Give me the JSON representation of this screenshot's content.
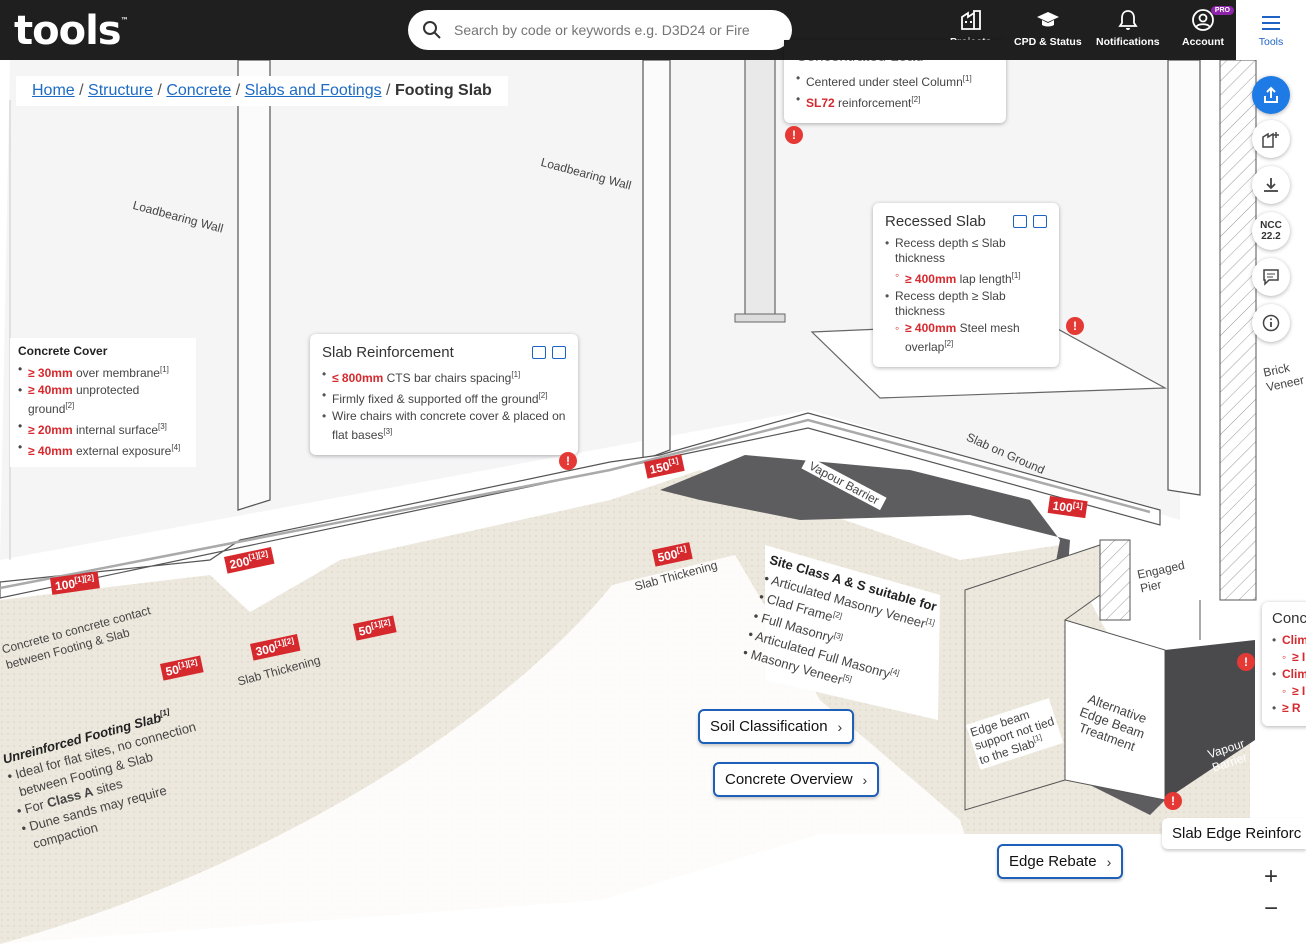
{
  "header": {
    "logo": "tools",
    "logo_tm": "™",
    "search_placeholder": "Search by code or keywords e.g. D3D24 or Fire",
    "nav": {
      "projects": "Projects",
      "cpd": "CPD & Status",
      "notifications": "Notifications",
      "account": "Account",
      "account_badge": "PRO",
      "tools": "Tools"
    }
  },
  "breadcrumb": {
    "items": [
      "Home",
      "Structure",
      "Concrete",
      "Slabs and Footings"
    ],
    "sep": "/",
    "current": "Footing Slab"
  },
  "concrete_cover": {
    "title": "Concrete Cover",
    "items": [
      {
        "v": "≥ 30mm",
        "t": " over membrane",
        "s": "[1]"
      },
      {
        "v": "≥ 40mm",
        "t": " unprotected ground",
        "s": "[2]"
      },
      {
        "v": "≥ 20mm",
        "t": " internal surface",
        "s": "[3]"
      },
      {
        "v": "≥ 40mm",
        "t": " external exposure",
        "s": "[4]"
      }
    ]
  },
  "slab_reinforcement": {
    "title": "Slab Reinforcement",
    "i1": {
      "v": "≤ 800mm",
      "t": " CTS bar chairs spacing",
      "s": "[1]"
    },
    "i2": {
      "t": "Firmly fixed & supported off the ground",
      "s": "[2]"
    },
    "i3": {
      "t": "Wire chairs with concrete cover & placed on flat bases",
      "s": "[3]"
    }
  },
  "concentrated_load": {
    "title": "Concentrated Load",
    "i1": {
      "t": "Centered under steel Column",
      "s": "[1]"
    },
    "i2": {
      "v": "SL72",
      "t": " reinforcement",
      "s": "[2]"
    }
  },
  "recessed_slab": {
    "title": "Recessed Slab",
    "i1": {
      "t": "Recess depth ≤ Slab thickness"
    },
    "i1s": {
      "v": "≥ 400mm",
      "t": " lap length",
      "s": "[1]"
    },
    "i2": {
      "t": "Recess depth ≥ Slab thickness"
    },
    "i2s": {
      "v": "≥ 400mm",
      "t": " Steel mesh overlap",
      "s": "[2]"
    }
  },
  "site_class": {
    "title": "Site Class A & S suitable for",
    "items": [
      {
        "t": "Articulated Masonry Veneer",
        "s": "[1]"
      },
      {
        "t": "Clad Frame",
        "s": "[2]"
      },
      {
        "t": "Full Masonry",
        "s": "[3]"
      },
      {
        "t": "Articulated Full Masonry",
        "s": "[4]"
      },
      {
        "t": "Masonry Veneer",
        "s": "[5]"
      }
    ]
  },
  "unreinforced": {
    "title": "Unreinforced Footing Slab",
    "title_s": "[1]",
    "l1": "Ideal for flat sites, no connection",
    "l2": "between Footing & Slab",
    "l3a": "For ",
    "l3b": "Class A",
    "l3c": " sites",
    "l4": "Dune sands may require",
    "l5": "compaction"
  },
  "contact_note": {
    "l1": "Concrete to concrete contact",
    "l2": "between Footing & Slab"
  },
  "scene_labels": {
    "loadbearing_wall": "Loadbearing Wall",
    "vapour_barrier": "Vapour Barrier",
    "slab_on_ground": "Slab on Ground",
    "slab_thickening": "Slab Thickening",
    "engaged_pier_1": "Engaged",
    "engaged_pier_2": "Pier",
    "alt_edge_1": "Alternative",
    "alt_edge_2": "Edge Beam",
    "alt_edge_3": "Treatment",
    "edge_beam_1": "Edge beam",
    "edge_beam_2": "support not tied",
    "edge_beam_3": "to the Slab",
    "edge_beam_s": "[1]",
    "vapour_1": "Vapour",
    "vapour_2": "Barrier",
    "brick_veneer_1": "Brick",
    "brick_veneer_2": "Veneer"
  },
  "dimensions": {
    "d100a": {
      "v": "100",
      "s": "[1][2]"
    },
    "d200": {
      "v": "200",
      "s": "[1][2]"
    },
    "d150": {
      "v": "150",
      "s": "[1]"
    },
    "d500": {
      "v": "500",
      "s": "[1]"
    },
    "d300": {
      "v": "300",
      "s": "[1][2]"
    },
    "d50a": {
      "v": "50",
      "s": "[1][2]"
    },
    "d50b": {
      "v": "50",
      "s": "[1][2]"
    },
    "d100b": {
      "v": "100",
      "s": "[1]"
    }
  },
  "warn_glyph": "!",
  "pills": {
    "soil": "Soil Classification",
    "concrete": "Concrete Overview",
    "edge_rebate": "Edge Rebate",
    "slab_edge": "Slab Edge Reinforc",
    "chevron": "›"
  },
  "partial_card": {
    "title": "Conc",
    "l1": "Clim",
    "l1b": "≥ I",
    "l2": "Clim",
    "l2b": "≥ I",
    "l3": "≥ R"
  },
  "rail": {
    "ncc_1": "NCC",
    "ncc_2": "22.2"
  },
  "zoom": {
    "plus": "+",
    "minus": "−"
  },
  "colors": {
    "accent": "#1e63c4",
    "header_bg": "#1f1f1f",
    "warning": "#e53935",
    "dimension": "#d6292e"
  }
}
